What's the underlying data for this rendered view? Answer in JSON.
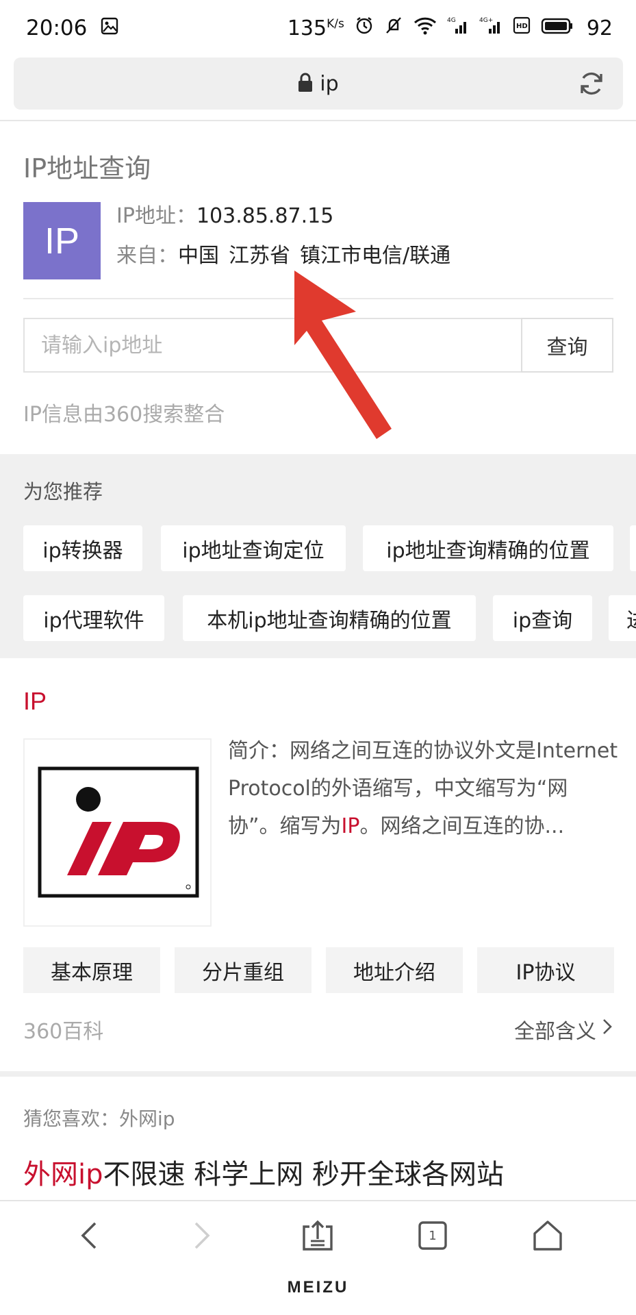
{
  "status_bar": {
    "time": "20:06",
    "speed": "135",
    "speed_unit": "K/s",
    "battery": "92"
  },
  "url_bar": {
    "url": "ip"
  },
  "ip_card": {
    "title": "IP地址查询",
    "logo_text": "IP",
    "address_label": "IP地址：",
    "address_value": "103.85.87.15",
    "from_label": "来自：",
    "from_country": "中国",
    "from_province": "江苏省",
    "from_city": "镇江市电信/联通",
    "input_placeholder": "请输入ip地址",
    "query_button": "查询",
    "source_note": "IP信息由360搜索整合"
  },
  "recommend": {
    "title": "为您推荐",
    "chips_row1": [
      "ip转换器",
      "ip地址查询定位",
      "ip地址查询精确的位置",
      ""
    ],
    "chips_row2": [
      "ip代理软件",
      "本机ip地址查询精确的位置",
      "ip查询",
      "进"
    ]
  },
  "baike": {
    "title": "IP",
    "desc_1": "简介：网络之间互连的协议外文是Internet Protocol的外语缩写，中文缩写为“网协”。缩写为",
    "desc_hl": "IP",
    "desc_2": "。网络之间互连的协...",
    "sections": [
      "基本原理",
      "分片重组",
      "地址介绍",
      "IP协议"
    ],
    "source": "360百科",
    "more": "全部含义"
  },
  "guess": {
    "label": "猜您喜欢：外网ip",
    "link_hl": "外网ip",
    "link_rest": "不限速 科学上网 秒开全球各网站"
  },
  "device": {
    "brand": "MEIZU",
    "tab_count": "1"
  },
  "colors": {
    "accent_red": "#c8102e",
    "ip_logo_bg": "#7b72cb",
    "section_gray": "#f0f0f0"
  }
}
